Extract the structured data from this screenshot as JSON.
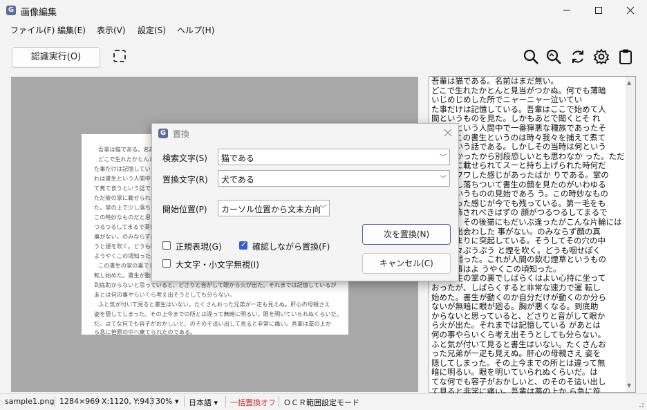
{
  "window": {
    "title": "画像編集",
    "app_icon_glyph": "G",
    "minimize_icon": "minimize-icon",
    "maximize_icon": "maximize-icon",
    "close_icon": "close-icon"
  },
  "menu": [
    {
      "label": "ファイル(F)"
    },
    {
      "label": "編集(E)"
    },
    {
      "label": "表示(V)"
    },
    {
      "label": "設定(S)"
    },
    {
      "label": "ヘルプ(H)"
    }
  ],
  "toolbar": {
    "ocr_button_label": "認識実行(O)",
    "icons": [
      "selection-area-icon",
      "search-icon",
      "zoom-search-icon",
      "rotate-refresh-icon",
      "gear-icon",
      "clipboard-icon"
    ]
  },
  "page_text": {
    "lines": [
      "吾輩は猫である。名前はまだ無い。",
      "どこで生れたかとんと見当がつかぬ。何でも薄暗いじめじめした所でニャーニャー泣いていた事",
      "た事だけは記憶している。吾輩はここで始めて人間というものを見た。しかもあとで聞くとそれ",
      "れは書生という人間中で一番獰悪な種族であったそうだ。この書生というのは時々我々を捕えて",
      "て煮て食うという話である。しかしその当時は何という考もなかったから別段恐しいとも思わなかった。",
      "ただ彼の掌に載せられてスーと持ち上げられた時何だかフワフワした感じがあったばかりである。",
      "た。掌の上で少し落ちついて書生の顔を見たのがいわゆる人間というものの見始であろう。",
      "この時妙なものだと思った感じが今でも残っている。第一毛をもって装飾されべきはずの顔が",
      "つるつるしてまるで薬缶だ。その後猫にもだいぶ逢ったがこんな片輪には一度も出会わした事がない。",
      "事がない。のみならず顔の真中があまりに突起している。そうしてその穴の中から時々ぷうぷうと煙",
      "うと煙を吹く。どうも咽せぽくて実に弱った。これが人間の飲む煙草というものである事はよう",
      "ようやくこの頃知った。",
      "この書生の掌の裏でしばらくはよい心持に坐っておったが、しばらくすると非常な速力で運",
      "転し始めた。書生が動くのか自分だけが動くのか分らないが無暗に眼が廻る。胸が悪くなる。",
      "到底助からないと思っていると、どさりと音がして眼から火が出た。それまでは記憶しているが",
      "あとは何の事やらいくら考え出そうとしても分らない。",
      "ふと気が付いて見ると書生はいない。たくさんおった兄弟が一疋も見えぬ。肝心の母親さえ",
      "姿を隠してしまった。その上今までの所とは違って無暗に明るい。眼を明いていられぬくらいだ。",
      "だ。はてな何でも容子がおかしいと、のそのそ這い出して見ると非常に痛い。吾輩は藁の上か",
      "ら急に笹原の中へ棄てられたのである。"
    ]
  },
  "ocr_text": "吾輩は猫である。名前はまだ無い。\nどこで生れたかとんと見当がつかぬ。何でも薄暗\nいじめじめした所でニャーニャー泣いてい\nた事だけは記憶している。吾輩はここで始めて人\n間というものを見た。しかもあとで聞くとそ れ\nは書生という人間中で一番獰悪な種族であったそ\nうだ。この書生というのは時々我々を捕えて煮て\n食うという話である。しかしその当時は何という\n考もなかったから別段恐しいとも思わなか った。ただ\n彼の掌に載せられてスーと持ち上げられた時何だ\nかフワフワした感じがあったばか りである。掌の\n上で少し落ちついて書生の顔を見たのがいわゆる\n人間というものの見始であろ う。この時妙なもの\nだと思った感じが今でも残っている。第一毛をも\nって装飾されべきはずの 顔がつるつるしてまるで\n薬缶だ。その後猫にもだいぶ逢ったがこんな片輪には\n一度も出会わした 事がない。のみならず顔の真\n中があまりに突起している。そうしてその穴の中\nから時々ぷうぷう と煙を吹く。どうも咽せぽく\nて実に弱った。これが人間の飲む煙草というもの\nである事はよ うやくこの頃知った。\nこの書生の掌の裏でしばらくはよい心持に坐って\nおったが、しばらくすると非常な速力で運 転し\n始めた。書生が動くのか自分だけが動くのか分ら\nないが無暗に眼が廻る。胸が悪くなる。到底助\nからないと思っていると、どさりと音がして眼か\nら火が出た。それまでは記憶している があとは\n何の事やらいくら考え出そうとしても分らない。\nふと気が付いて見ると書生はいない。たくさんお\nった兄弟が一疋も見えぬ。肝心の母親さえ 姿を\n隠してしまった。その上今までの所とは違って無\n暗に明るい。眼を明いていられぬくらいだ。は\nてな何でも容子がおかしいと、のそのそ這い出し\nて見ると非常に痛い。吾輩は藁の上か ら急に笹\n原の中へ棄てられたのである。",
  "dialog": {
    "title": "置換",
    "search_label": "検索文字(S)",
    "search_value": "猫である",
    "replace_label": "置換文字(R)",
    "replace_value": "犬である",
    "start_label": "開始位置(P)",
    "start_value": "カーソル位置から文末方向",
    "regex_label": "正規表現(G)",
    "regex_checked": false,
    "confirm_label": "確認しながら置換(F)",
    "confirm_checked": true,
    "case_label": "大文字・小文字無視(I)",
    "case_checked": false,
    "next_button": "次を置換(N)",
    "cancel_button": "キャンセル(C)",
    "close_icon": "close-icon"
  },
  "status": {
    "filename": "sample1.png",
    "dimensions": "1284×969",
    "coords": "X:1120, Y:943",
    "zoom": "30%",
    "language": "日本語",
    "replace_mode": "一括置換オフ",
    "replace_mode_color": "#d32f2f",
    "ocr_mode": "ＯＣＲ範囲設定モード"
  }
}
